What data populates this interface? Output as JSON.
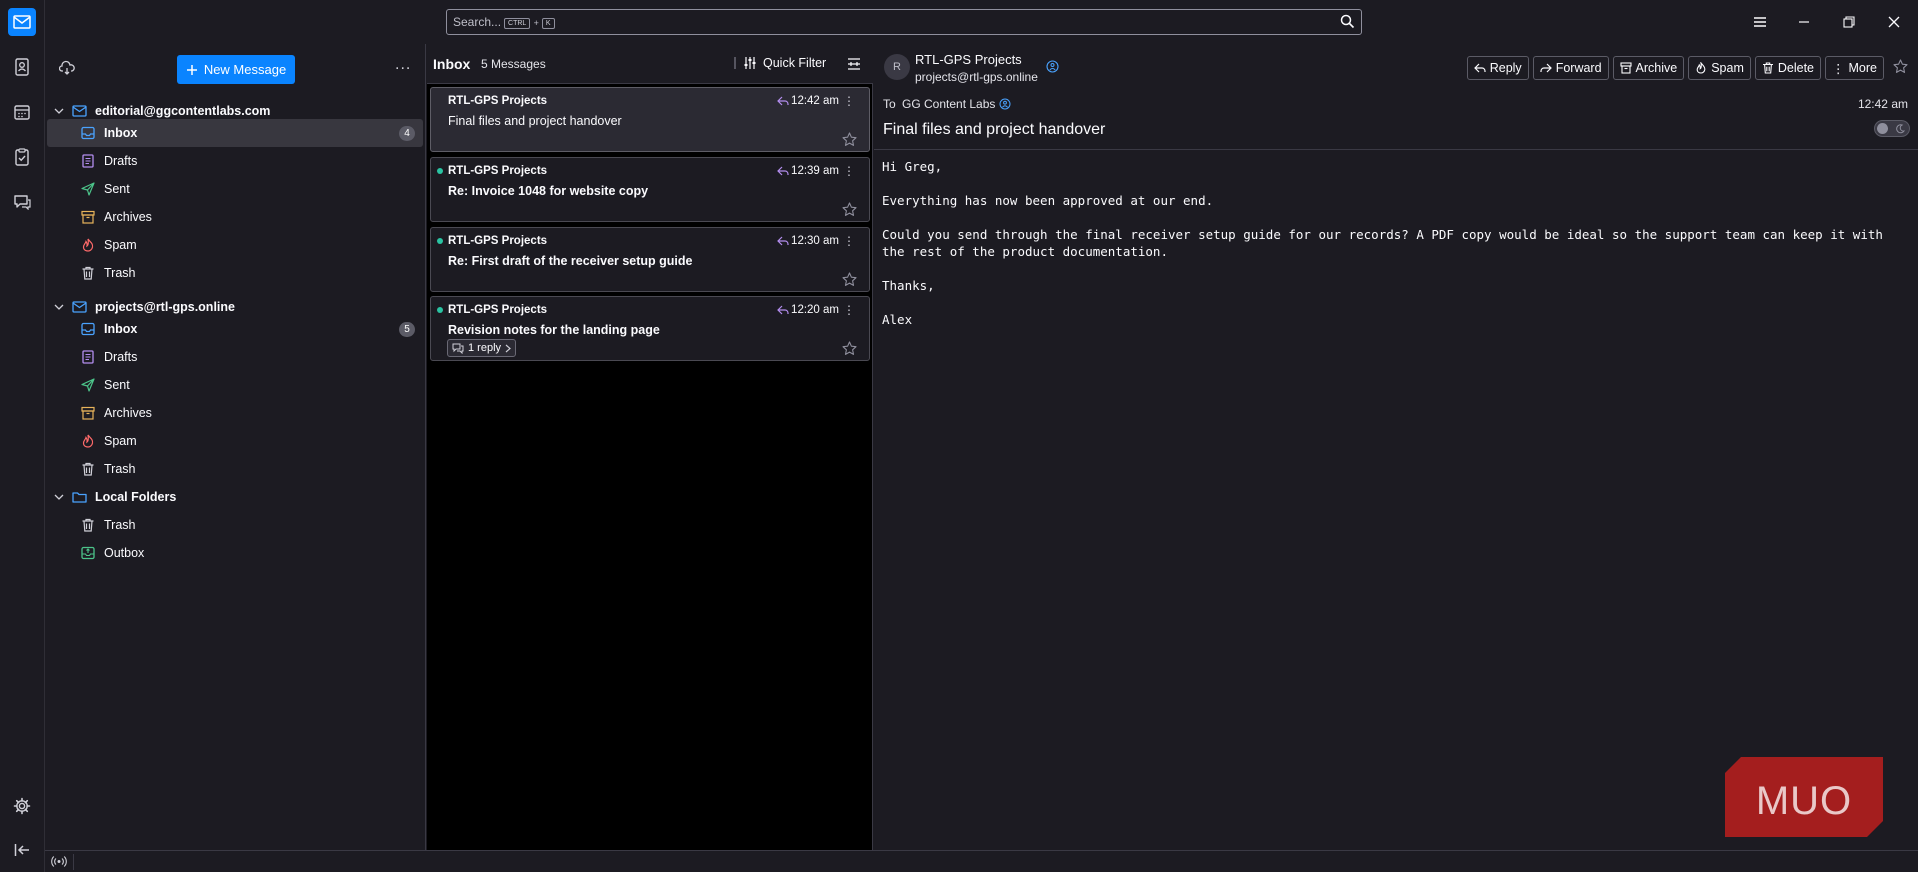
{
  "search": {
    "placeholder": "Search...",
    "shortcut_ctrl": "CTRL",
    "shortcut_plus": "+",
    "shortcut_key": "K"
  },
  "toolbar": {
    "new_message_label": "New Message",
    "more_label": "..."
  },
  "accounts": [
    {
      "name": "editorial@ggcontentlabs.com",
      "folders": [
        {
          "label": "Inbox",
          "icon": "inbox-icon",
          "badge": "4",
          "selected": true
        },
        {
          "label": "Drafts",
          "icon": "drafts-icon"
        },
        {
          "label": "Sent",
          "icon": "sent-icon"
        },
        {
          "label": "Archives",
          "icon": "archive-icon"
        },
        {
          "label": "Spam",
          "icon": "spam-icon"
        },
        {
          "label": "Trash",
          "icon": "trash-icon"
        }
      ]
    },
    {
      "name": "projects@rtl-gps.online",
      "folders": [
        {
          "label": "Inbox",
          "icon": "inbox-icon",
          "badge": "5"
        },
        {
          "label": "Drafts",
          "icon": "drafts-icon"
        },
        {
          "label": "Sent",
          "icon": "sent-icon"
        },
        {
          "label": "Archives",
          "icon": "archive-icon"
        },
        {
          "label": "Spam",
          "icon": "spam-icon"
        },
        {
          "label": "Trash",
          "icon": "trash-icon"
        }
      ]
    },
    {
      "name": "Local Folders",
      "folders": [
        {
          "label": "Trash",
          "icon": "trash-icon"
        },
        {
          "label": "Outbox",
          "icon": "outbox-icon"
        }
      ]
    }
  ],
  "message_list": {
    "folder_title": "Inbox",
    "count_label": "5 Messages",
    "quick_filter_label": "Quick Filter",
    "messages": [
      {
        "sender": "RTL-GPS Projects",
        "subject": "Final files and project handover",
        "time": "12:42 am",
        "unread": false,
        "selected": true
      },
      {
        "sender": "RTL-GPS Projects",
        "subject": "Re: Invoice 1048 for website copy",
        "time": "12:39 am",
        "unread": true
      },
      {
        "sender": "RTL-GPS Projects",
        "subject": "Re: First draft of the receiver setup guide",
        "time": "12:30 am",
        "unread": true
      },
      {
        "sender": "RTL-GPS Projects",
        "subject": "Revision notes for the landing page",
        "time": "12:20 am",
        "unread": true,
        "thread_label": "1 reply"
      }
    ]
  },
  "reader": {
    "avatar_letter": "R",
    "from_name": "RTL-GPS Projects",
    "from_address": "projects@rtl-gps.online",
    "to_label": "To",
    "to_value": "GG Content Labs",
    "time": "12:42 am",
    "subject": "Final files and project handover",
    "actions": {
      "reply": "Reply",
      "forward": "Forward",
      "archive": "Archive",
      "spam": "Spam",
      "delete": "Delete",
      "more": "More"
    },
    "body": [
      "Hi Greg,",
      "Everything has now been approved at our end.",
      "Could you send through the final receiver setup guide for our records? A PDF copy would be ideal so the support team can keep it with the rest of the product documentation.",
      "Thanks,",
      "Alex"
    ]
  },
  "watermark": "MUO",
  "colors": {
    "accent": "#0a84ff",
    "unread_dot": "#2ac3a2",
    "background": "#1c1b22",
    "list_background": "#000000",
    "watermark": "#b01e1e"
  }
}
